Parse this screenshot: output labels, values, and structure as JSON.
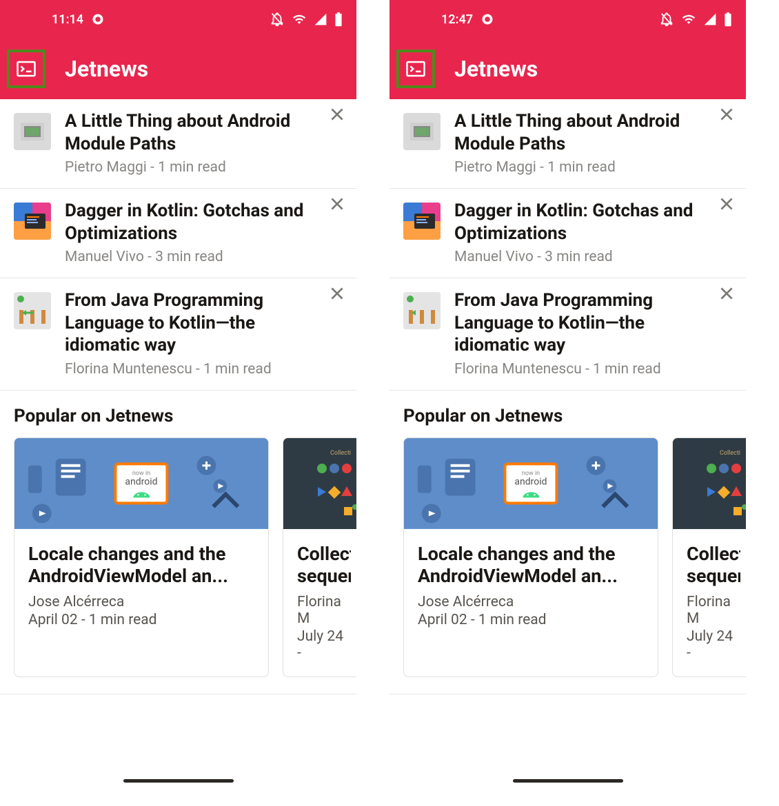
{
  "screens": [
    {
      "time": "11:14"
    },
    {
      "time": "12:47"
    }
  ],
  "app": {
    "title": "Jetnews"
  },
  "posts": [
    {
      "title": "A Little Thing about Android Module Paths",
      "meta": "Pietro Maggi - 1 min read"
    },
    {
      "title": "Dagger in Kotlin: Gotchas and Optimizations",
      "meta": "Manuel Vivo - 3 min read"
    },
    {
      "title": "From Java Programming Language to Kotlin—the idiomatic way",
      "meta": "Florina Muntenescu - 1 min read"
    }
  ],
  "section": {
    "popular": "Popular on Jetnews"
  },
  "cards": [
    {
      "title": "Locale changes and the AndroidViewModel an...",
      "author": "Jose Alcérreca",
      "date": "April 02 - 1 min read"
    },
    {
      "title": "Collect sequen",
      "author": "Florina M",
      "date": "July 24 - "
    }
  ]
}
